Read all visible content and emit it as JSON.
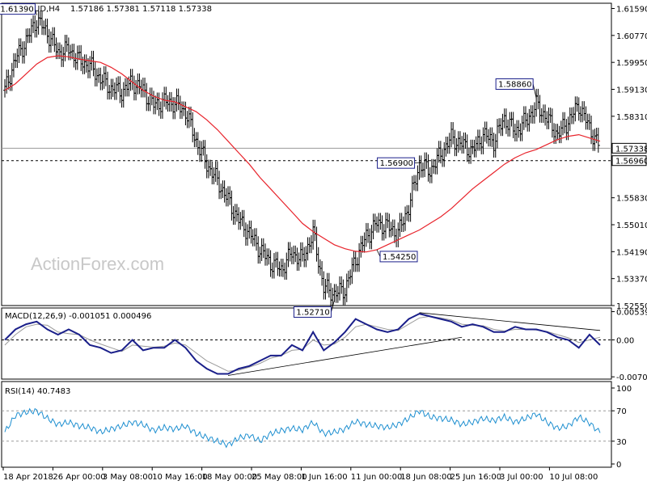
{
  "header": {
    "symbol": "EURAUD,H4",
    "ohlc": "1.57186 1.57381 1.57118 1.57338"
  },
  "watermark": "ActionForex.com",
  "colors": {
    "price_bars": "#000000",
    "moving_average": "#e8232b",
    "macd_main": "#1a1f8a",
    "macd_signal": "#9a9a9a",
    "rsi_line": "#1e8fd0",
    "trendline": "#000000",
    "label_border": "#1a1f8a"
  },
  "chart_data": [
    {
      "id": "price",
      "type": "ohlc",
      "title": "EURAUD,H4",
      "ylim": [
        1.5255,
        1.6175
      ],
      "y_ticks": [
        "1.61590",
        "1.60770",
        "1.59950",
        "1.59130",
        "1.58310",
        "1.57338",
        "1.56960",
        "1.55830",
        "1.55010",
        "1.54190",
        "1.53370",
        "1.52550"
      ],
      "current_price": "1.57338",
      "reference_level": "1.56960",
      "annotations": [
        "1.61390",
        "1.56900",
        "1.58860",
        "1.54250",
        "1.52710"
      ],
      "ma_series": [
        1.591,
        1.593,
        1.596,
        1.599,
        1.601,
        1.6015,
        1.6012,
        1.6005,
        1.6,
        1.5995,
        1.598,
        1.596,
        1.5935,
        1.591,
        1.5892,
        1.588,
        1.5875,
        1.586,
        1.5845,
        1.582,
        1.579,
        1.5755,
        1.572,
        1.5685,
        1.5645,
        1.561,
        1.5575,
        1.554,
        1.5505,
        1.548,
        1.546,
        1.544,
        1.5428,
        1.542,
        1.5418,
        1.5425,
        1.544,
        1.5455,
        1.547,
        1.5485,
        1.5505,
        1.5525,
        1.555,
        1.558,
        1.561,
        1.5635,
        1.566,
        1.5685,
        1.5705,
        1.572,
        1.573,
        1.5745,
        1.576,
        1.577,
        1.5775,
        1.5765,
        1.5755
      ],
      "close_series": [
        1.591,
        1.6005,
        1.606,
        1.6125,
        1.6085,
        1.6025,
        1.6035,
        1.6,
        1.5985,
        1.5945,
        1.5915,
        1.5905,
        1.5935,
        1.591,
        1.5865,
        1.5875,
        1.587,
        1.5845,
        1.5755,
        1.5685,
        1.5635,
        1.5575,
        1.5515,
        1.5475,
        1.5425,
        1.5385,
        1.5365,
        1.5415,
        1.5395,
        1.5475,
        1.531,
        1.529,
        1.5305,
        1.5395,
        1.5465,
        1.5505,
        1.5495,
        1.5475,
        1.5555,
        1.5685,
        1.5665,
        1.5715,
        1.5765,
        1.5745,
        1.5725,
        1.5775,
        1.5755,
        1.5825,
        1.5785,
        1.5815,
        1.5865,
        1.5825,
        1.5775,
        1.5815,
        1.5865,
        1.5795,
        1.5734
      ]
    },
    {
      "id": "macd",
      "type": "line",
      "title": "MACD(12,26,9) -0.001051 0.000496",
      "ylim": [
        -0.0075,
        0.0061
      ],
      "y_ticks": [
        "0.005398",
        "0.00",
        "-0.007064"
      ],
      "series": [
        {
          "name": "MACD",
          "values": [
            0.0,
            0.002,
            0.003,
            0.0035,
            0.002,
            0.001,
            0.002,
            0.001,
            -0.001,
            -0.0015,
            -0.0025,
            -0.002,
            0.0,
            -0.002,
            -0.0015,
            -0.0015,
            0.0,
            -0.0015,
            -0.004,
            -0.0055,
            -0.0065,
            -0.0065,
            -0.0055,
            -0.005,
            -0.004,
            -0.003,
            -0.003,
            -0.001,
            -0.002,
            0.0015,
            -0.002,
            -0.0005,
            0.0015,
            0.004,
            0.003,
            0.002,
            0.0015,
            0.002,
            0.004,
            0.005,
            0.0045,
            0.004,
            0.0035,
            0.0025,
            0.003,
            0.0025,
            0.0015,
            0.0015,
            0.0025,
            0.002,
            0.002,
            0.0015,
            0.0005,
            0.0,
            -0.0015,
            0.001,
            -0.001
          ]
        },
        {
          "name": "Signal",
          "values": [
            -0.001,
            0.001,
            0.0025,
            0.003,
            0.0028,
            0.0015,
            0.0012,
            0.001,
            0.0,
            -0.0008,
            -0.0015,
            -0.0022,
            -0.001,
            -0.0012,
            -0.0014,
            -0.0012,
            -0.0006,
            -0.001,
            -0.0025,
            -0.004,
            -0.005,
            -0.006,
            -0.0058,
            -0.0052,
            -0.0045,
            -0.0035,
            -0.003,
            -0.002,
            -0.0018,
            0.0,
            -0.001,
            -0.0008,
            0.0005,
            0.0025,
            0.003,
            0.0025,
            0.002,
            0.0018,
            0.003,
            0.0042,
            0.0045,
            0.0042,
            0.0038,
            0.003,
            0.0028,
            0.0027,
            0.002,
            0.0017,
            0.002,
            0.002,
            0.0019,
            0.0016,
            0.001,
            0.0004,
            -0.0005,
            0.0,
            0.0005
          ]
        }
      ],
      "zero_line": 0.0
    },
    {
      "id": "rsi",
      "type": "line",
      "title": "RSI(14) 40.7483",
      "ylim": [
        0,
        100
      ],
      "y_ticks": [
        "100",
        "70",
        "30",
        "0"
      ],
      "levels": [
        70,
        30
      ],
      "series": [
        {
          "name": "RSI(14)",
          "values": [
            42,
            64,
            68,
            70,
            60,
            52,
            55,
            50,
            48,
            42,
            46,
            50,
            55,
            52,
            44,
            48,
            46,
            50,
            40,
            35,
            30,
            25,
            34,
            38,
            30,
            40,
            44,
            47,
            45,
            55,
            40,
            42,
            46,
            56,
            52,
            50,
            48,
            52,
            60,
            70,
            62,
            60,
            58,
            52,
            55,
            60,
            57,
            62,
            55,
            60,
            66,
            55,
            47,
            50,
            62,
            54,
            41
          ]
        }
      ]
    }
  ],
  "x_axis": {
    "tick_labels": [
      "18 Apr 2018",
      "26 Apr 00:00",
      "3 May 08:00",
      "10 May 16:00",
      "18 May 00:00",
      "25 May 08:00",
      "1 Jun 16:00",
      "11 Jun 00:00",
      "18 Jun 08:00",
      "25 Jun 16:00",
      "3 Jul 00:00",
      "10 Jul 08:00"
    ]
  }
}
